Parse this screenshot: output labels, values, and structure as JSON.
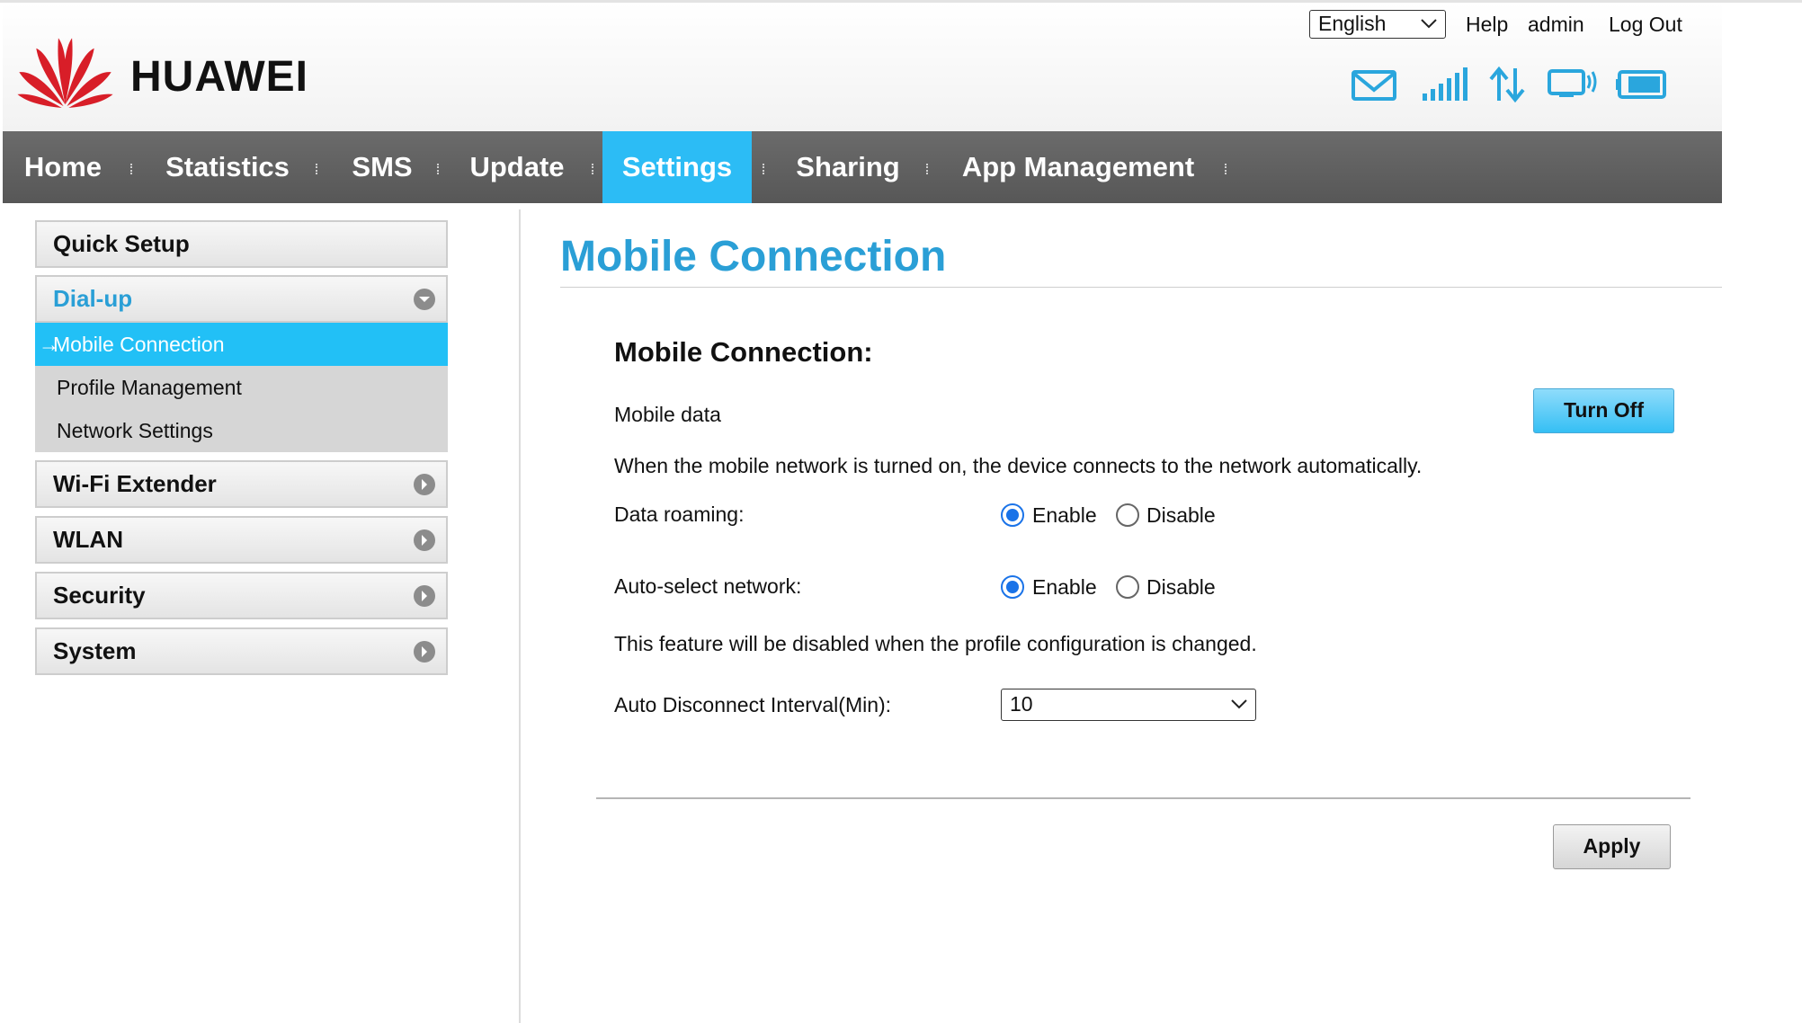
{
  "brand": "HUAWEI",
  "header": {
    "language": "English",
    "links": {
      "help": "Help",
      "user": "admin",
      "logout": "Log Out"
    },
    "status_icons": [
      "mail-icon",
      "signal-bars-icon",
      "data-transfer-icon",
      "wifi-device-icon",
      "battery-icon"
    ]
  },
  "nav": {
    "items": [
      "Home",
      "Statistics",
      "SMS",
      "Update",
      "Settings",
      "Sharing",
      "App Management"
    ],
    "active": "Settings"
  },
  "sidebar": {
    "quick_setup": "Quick Setup",
    "dialup": "Dial-up",
    "dialup_items": [
      "Mobile Connection",
      "Profile Management",
      "Network Settings"
    ],
    "active_item_arrow": "→",
    "wifi_extender": "Wi-Fi Extender",
    "wlan": "WLAN",
    "security": "Security",
    "system": "System"
  },
  "main": {
    "page_title": "Mobile Connection",
    "section_title": "Mobile Connection:",
    "mobile_data_label": "Mobile data",
    "turn_off_button": "Turn Off",
    "auto_connect_note": "When the mobile network is turned on, the device connects to the network automatically.",
    "data_roaming_label": "Data roaming:",
    "auto_select_label": "Auto-select network:",
    "enable": "Enable",
    "disable": "Disable",
    "data_roaming_value": "Enable",
    "auto_select_value": "Enable",
    "profile_note": "This feature will be disabled when the profile configuration is changed.",
    "auto_disconnect_label": "Auto Disconnect Interval(Min):",
    "auto_disconnect_value": "10",
    "apply_button": "Apply"
  },
  "colors": {
    "accent": "#2cbcf5",
    "title_blue": "#2a9fd6",
    "nav_bg": "#616161",
    "huawei_red": "#d81e28"
  }
}
